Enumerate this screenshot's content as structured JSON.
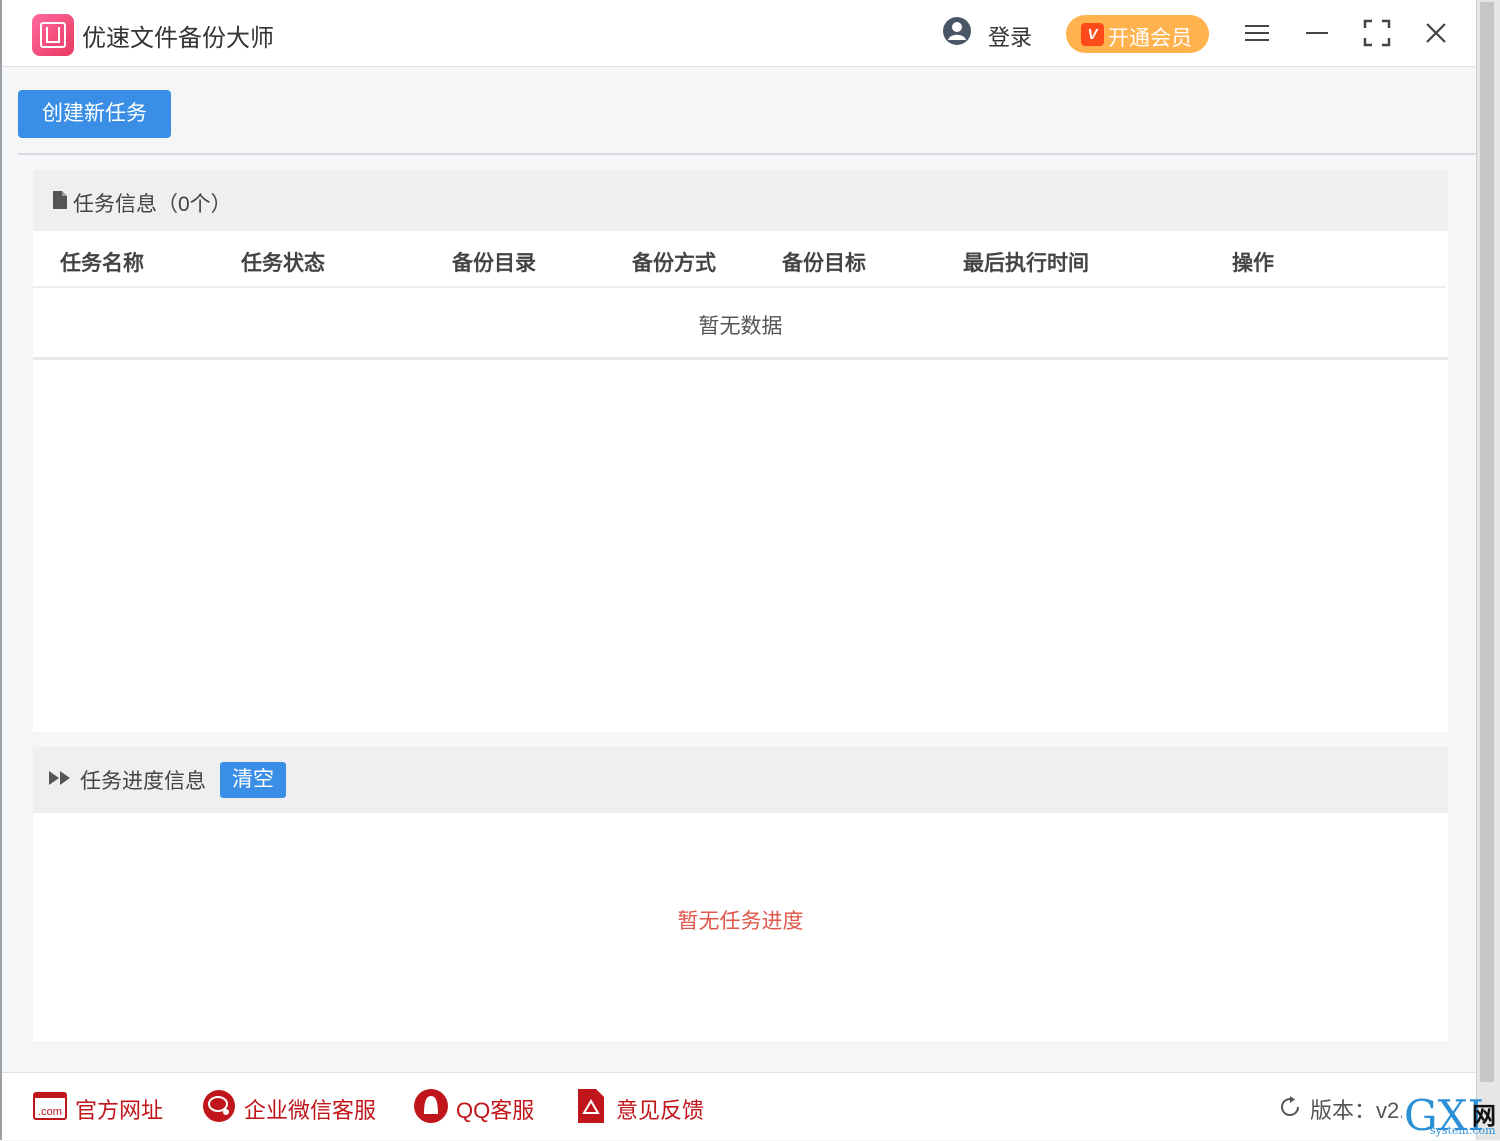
{
  "app": {
    "title": "优速文件备份大师"
  },
  "header": {
    "login_label": "登录",
    "vip_badge": "V",
    "vip_label": "开通会员"
  },
  "toolbar": {
    "create_label": "创建新任务"
  },
  "task_panel": {
    "title": "任务信息（0个）",
    "columns": [
      "任务名称",
      "任务状态",
      "备份目录",
      "备份方式",
      "备份目标",
      "最后执行时间",
      "操作"
    ],
    "empty_text": "暂无数据"
  },
  "progress_panel": {
    "title": "任务进度信息",
    "clear_label": "清空",
    "empty_text": "暂无任务进度"
  },
  "footer": {
    "links": [
      {
        "label": "官方网址",
        "icon": "com-icon"
      },
      {
        "label": "企业微信客服",
        "icon": "wecom-icon"
      },
      {
        "label": "QQ客服",
        "icon": "qq-icon"
      },
      {
        "label": "意见反馈",
        "icon": "feedback-icon"
      }
    ],
    "version_text": "版本：v2.0"
  },
  "watermark": {
    "main": "GXI",
    "net": "网",
    "domain": "system.com"
  },
  "colors": {
    "primary": "#3a8ee6",
    "vip": "#ffb24d",
    "footer_link": "#c0161b",
    "empty_progress": "#e0574b"
  }
}
